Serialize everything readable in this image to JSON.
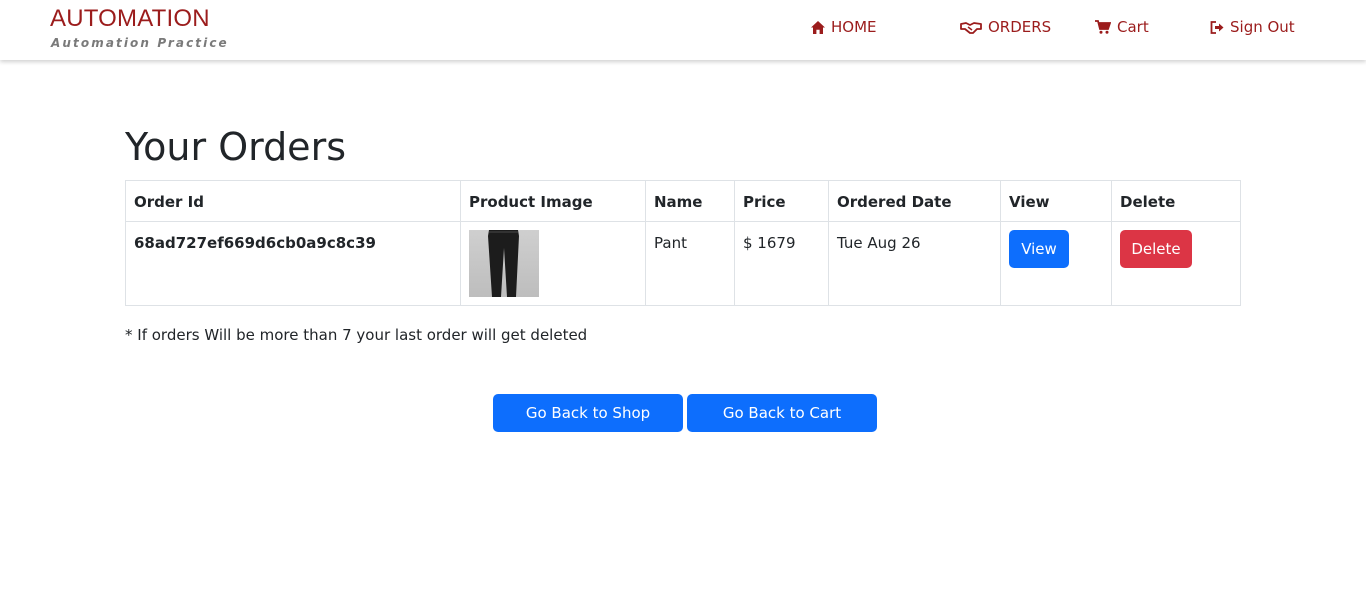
{
  "brand": {
    "title": "AUTOMATION",
    "subtitle": "Automation Practice"
  },
  "nav": {
    "home": {
      "label": "HOME",
      "icon": "home-icon"
    },
    "orders": {
      "label": "ORDERS",
      "icon": "handshake-icon"
    },
    "cart": {
      "label": "Cart",
      "icon": "cart-icon"
    },
    "signout": {
      "label": "Sign Out",
      "icon": "sign-out-icon"
    }
  },
  "page": {
    "title": "Your Orders"
  },
  "table": {
    "headers": [
      "Order Id",
      "Product Image",
      "Name",
      "Price",
      "Ordered Date",
      "View",
      "Delete"
    ],
    "rows": [
      {
        "order_id": "68ad727ef669d6cb0a9c8c39",
        "name": "Pant",
        "price": "$ 1679",
        "date": "Tue Aug 26",
        "view_label": "View",
        "delete_label": "Delete"
      }
    ]
  },
  "note": "* If orders Will be more than 7 your last order will get deleted",
  "actions": {
    "back_to_shop": "Go Back to Shop",
    "back_to_cart": "Go Back to Cart"
  },
  "colors": {
    "brand": "#9b1c1c",
    "primary": "#0d6efd",
    "danger": "#dc3545"
  }
}
